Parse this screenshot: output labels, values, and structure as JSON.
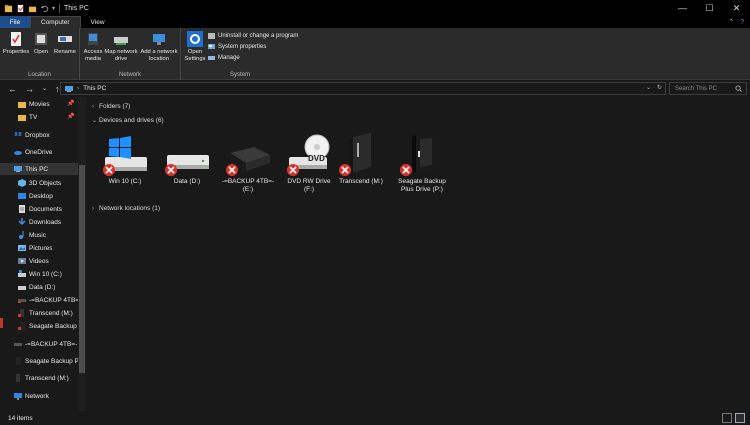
{
  "window": {
    "title": "This PC",
    "controls": [
      "minimize",
      "maximize",
      "close"
    ]
  },
  "tabs": [
    {
      "label": "File"
    },
    {
      "label": "Computer"
    },
    {
      "label": "View"
    }
  ],
  "ribbon": {
    "location": {
      "group_label": "Location",
      "buttons": [
        {
          "label": "Properties",
          "icon": "properties-icon"
        },
        {
          "label": "Open",
          "icon": "open-icon"
        },
        {
          "label": "Rename",
          "icon": "rename-icon"
        }
      ]
    },
    "network": {
      "group_label": "Network",
      "buttons": [
        {
          "label": "Access media",
          "icon": "access-media-icon"
        },
        {
          "label": "Map network drive",
          "icon": "map-drive-icon"
        },
        {
          "label": "Add a network location",
          "icon": "network-location-icon"
        }
      ]
    },
    "system": {
      "group_label": "System",
      "open_settings": "Open Settings",
      "small": [
        {
          "label": "Uninstall or change a program"
        },
        {
          "label": "System properties"
        },
        {
          "label": "Manage"
        }
      ]
    }
  },
  "address": {
    "path": "This PC",
    "search_placeholder": "Search This PC"
  },
  "navpane": {
    "items": [
      {
        "label": "Movies",
        "icon": "folder-icon",
        "pinned": true
      },
      {
        "label": "TV",
        "icon": "folder-icon",
        "pinned": true
      },
      {
        "label": "Dropbox",
        "icon": "dropbox-icon"
      },
      {
        "label": "OneDrive",
        "icon": "onedrive-icon"
      },
      {
        "label": "This PC",
        "icon": "pc-icon",
        "selected": true
      },
      {
        "label": "3D Objects",
        "icon": "3d-objects-icon"
      },
      {
        "label": "Desktop",
        "icon": "desktop-icon"
      },
      {
        "label": "Documents",
        "icon": "documents-icon"
      },
      {
        "label": "Downloads",
        "icon": "downloads-icon"
      },
      {
        "label": "Music",
        "icon": "music-icon"
      },
      {
        "label": "Pictures",
        "icon": "pictures-icon"
      },
      {
        "label": "Videos",
        "icon": "videos-icon"
      },
      {
        "label": "Win 10 (C:)",
        "icon": "drive-icon"
      },
      {
        "label": "Data (D:)",
        "icon": "drive-icon"
      },
      {
        "label": "-=BACKUP 4TB=-",
        "icon": "drive-icon"
      },
      {
        "label": "Transcend (M:)",
        "icon": "drive-icon"
      },
      {
        "label": "Seagate Backup",
        "icon": "drive-icon"
      },
      {
        "label": "-=BACKUP 4TB=-",
        "icon": "drive-icon"
      },
      {
        "label": "Seagate Backup P",
        "icon": "drive-icon"
      },
      {
        "label": "Transcend (M:)",
        "icon": "drive-icon"
      },
      {
        "label": "Network",
        "icon": "network-icon"
      }
    ]
  },
  "content": {
    "groups": [
      {
        "label": "Folders (7)",
        "expanded": false
      },
      {
        "label": "Devices and drives (6)",
        "expanded": true
      },
      {
        "label": "Network locations (1)",
        "expanded": false
      }
    ],
    "drives": [
      {
        "label": "Win 10 (C:)",
        "icon": "windows-drive-icon"
      },
      {
        "label": "Data (D:)",
        "icon": "hard-drive-icon"
      },
      {
        "label": "-=BACKUP 4TB=-\n(E:)",
        "icon": "external-drive-icon"
      },
      {
        "label": "DVD RW Drive\n(F:)",
        "icon": "dvd-drive-icon"
      },
      {
        "label": "Transcend (M:)",
        "icon": "portable-drive-icon"
      },
      {
        "label": "Seagate Backup\nPlus Drive (P:)",
        "icon": "seagate-drive-icon"
      }
    ]
  },
  "status": {
    "items_count": "14 items"
  }
}
